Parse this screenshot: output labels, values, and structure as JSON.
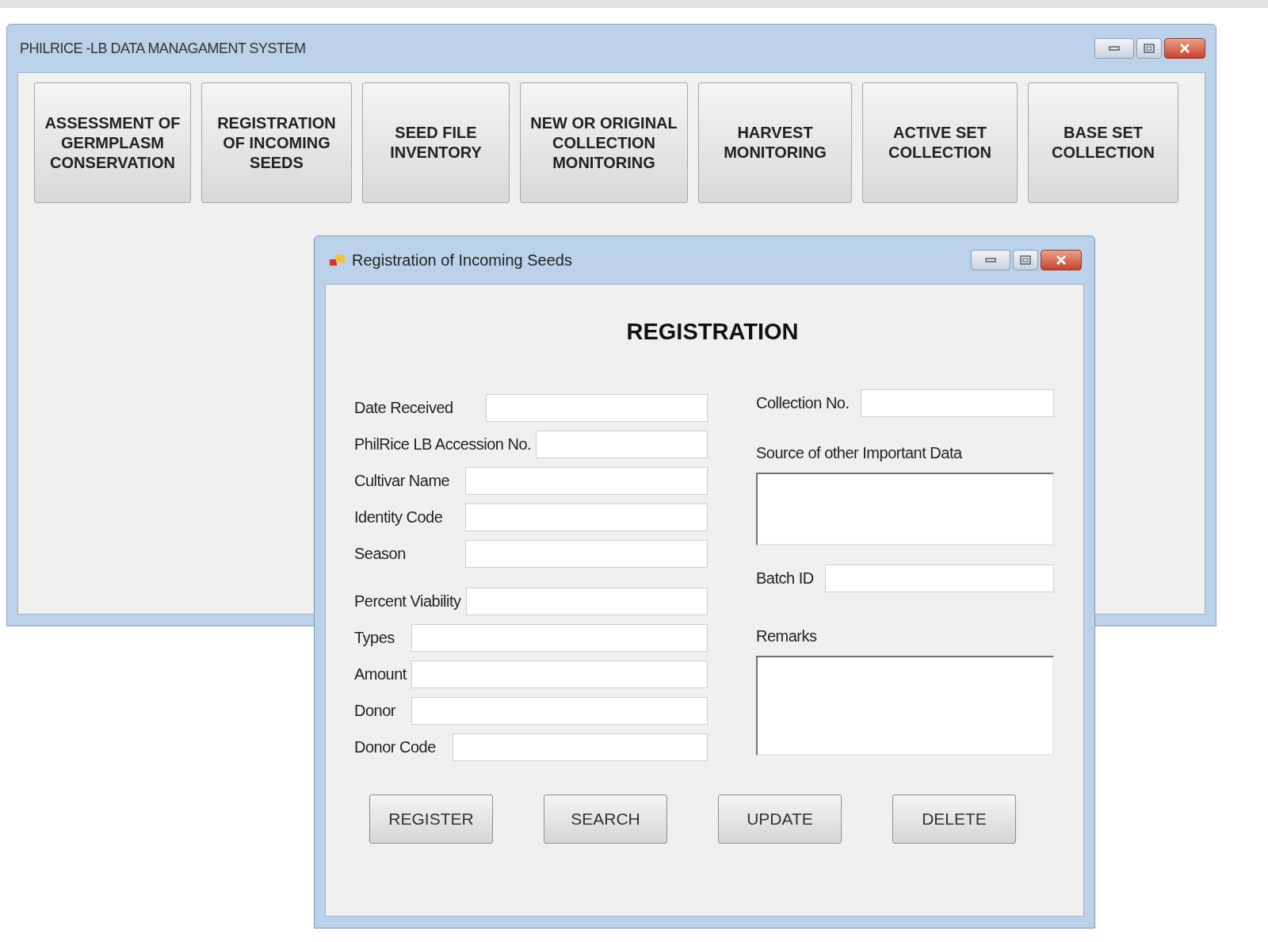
{
  "main_window": {
    "title": "PHILRICE -LB DATA MANAGAMENT SYSTEM"
  },
  "modules": [
    {
      "label": "ASSESSMENT OF GERMPLASM CONSERVATION"
    },
    {
      "label": "REGISTRATION OF INCOMING SEEDS"
    },
    {
      "label": "SEED FILE INVENTORY"
    },
    {
      "label": "NEW OR ORIGINAL COLLECTION MONITORING"
    },
    {
      "label": "HARVEST MONITORING"
    },
    {
      "label": "ACTIVE SET COLLECTION"
    },
    {
      "label": "BASE SET COLLECTION"
    }
  ],
  "dialog": {
    "title": "Registration of Incoming Seeds",
    "heading": "REGISTRATION",
    "left_fields": [
      {
        "label": "Date Received"
      },
      {
        "label": "PhilRice LB Accession No."
      },
      {
        "label": "Cultivar Name"
      },
      {
        "label": "Identity Code"
      },
      {
        "label": "Season"
      },
      {
        "label": "Percent Viability"
      },
      {
        "label": "Types"
      },
      {
        "label": "Amount"
      },
      {
        "label": "Donor"
      },
      {
        "label": "Donor Code"
      }
    ],
    "right_fields": [
      {
        "label": "Collection No.",
        "kind": "inline"
      },
      {
        "label": "Source of other Important Data",
        "kind": "multiline"
      },
      {
        "label": "Batch ID",
        "kind": "inline"
      },
      {
        "label": "Remarks",
        "kind": "multiline"
      }
    ],
    "buttons": [
      "REGISTER",
      "SEARCH",
      "UPDATE",
      "DELETE"
    ]
  }
}
